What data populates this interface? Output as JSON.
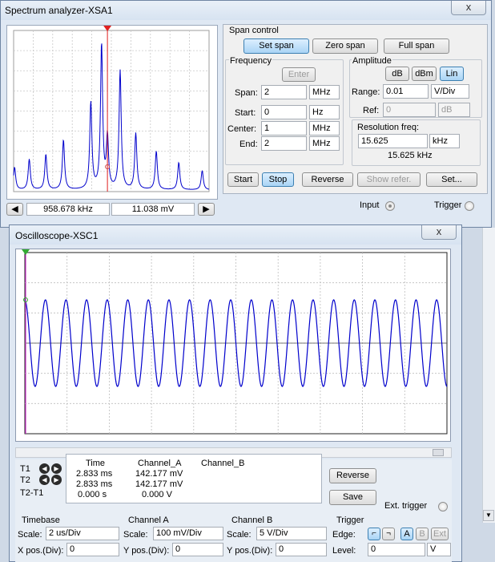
{
  "spectrum": {
    "title": "Spectrum analyzer-XSA1",
    "close_icon": "x",
    "marker_freq": "958.678 kHz",
    "marker_amp": "11.038 mV",
    "span_control": {
      "label": "Span control",
      "set_span": "Set span",
      "zero_span": "Zero span",
      "full_span": "Full span"
    },
    "frequency": {
      "label": "Frequency",
      "enter": "Enter",
      "span_label": "Span:",
      "span_value": "2",
      "span_unit": "MHz",
      "start_label": "Start:",
      "start_value": "0",
      "start_unit": "Hz",
      "center_label": "Center:",
      "center_value": "1",
      "center_unit": "MHz",
      "end_label": "End:",
      "end_value": "2",
      "end_unit": "MHz"
    },
    "amplitude": {
      "label": "Amplitude",
      "db": "dB",
      "dbm": "dBm",
      "lin": "Lin",
      "range_label": "Range:",
      "range_value": "0.01",
      "range_unit": "V/Div",
      "ref_label": "Ref:",
      "ref_value": "0",
      "ref_unit": "dB"
    },
    "resolution": {
      "label": "Resolution freq:",
      "value": "15.625",
      "unit": "kHz",
      "readout": "15.625 kHz"
    },
    "buttons": {
      "start": "Start",
      "stop": "Stop",
      "reverse": "Reverse",
      "show_refer": "Show refer.",
      "set": "Set..."
    },
    "input_label": "Input",
    "trigger_label": "Trigger",
    "colors": {
      "trace": "#0000cc",
      "marker": "#e02020",
      "grid": "#c8c8c8"
    }
  },
  "oscilloscope": {
    "title": "Oscilloscope-XSC1",
    "close_icon": "x",
    "readout": {
      "t1": "T1",
      "t2": "T2",
      "t2t1": "T2-T1",
      "header_time": "Time",
      "header_a": "Channel_A",
      "header_b": "Channel_B",
      "rows": [
        {
          "time": "2.833 ms",
          "a": "142.177 mV",
          "b": ""
        },
        {
          "time": "2.833 ms",
          "a": "142.177 mV",
          "b": ""
        },
        {
          "time": "0.000 s",
          "a": "0.000 V",
          "b": ""
        }
      ]
    },
    "reverse": "Reverse",
    "save": "Save",
    "ext_trigger": "Ext. trigger",
    "timebase": {
      "label": "Timebase",
      "scale_label": "Scale:",
      "scale_value": "2 us/Div",
      "pos_label": "X pos.(Div):",
      "pos_value": "0"
    },
    "channel_a": {
      "label": "Channel A",
      "scale_label": "Scale:",
      "scale_value": "100 mV/Div",
      "pos_label": "Y pos.(Div):",
      "pos_value": "0"
    },
    "channel_b": {
      "label": "Channel B",
      "scale_label": "Scale:",
      "scale_value": "5  V/Div",
      "pos_label": "Y pos.(Div):",
      "pos_value": "0"
    },
    "trigger": {
      "label": "Trigger",
      "edge_label": "Edge:",
      "a": "A",
      "b": "B",
      "ext": "Ext",
      "level_label": "Level:",
      "level_value": "0",
      "level_unit": "V"
    },
    "colors": {
      "trace": "#0000cc",
      "cursor": "#cc33cc"
    }
  }
}
